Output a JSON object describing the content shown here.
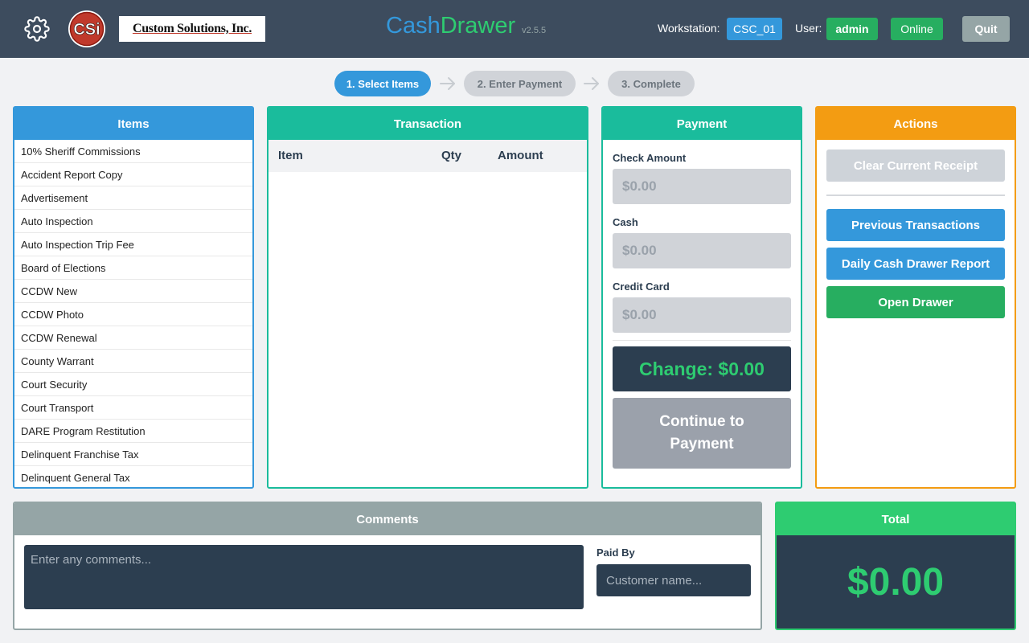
{
  "header": {
    "icons": {
      "settings": "gear-icon",
      "logo": "csi-logo"
    },
    "logo_text": "CSi",
    "company_name": "Custom Solutions, Inc.",
    "app_name_1": "Cash",
    "app_name_2": "Drawer",
    "version": "v2.5.5",
    "workstation_label": "Workstation:",
    "workstation": "CSC_01",
    "user_label": "User:",
    "user": "admin",
    "status": "Online",
    "quit_label": "Quit"
  },
  "steps": [
    {
      "label": "1. Select Items",
      "active": true
    },
    {
      "label": "2. Enter Payment",
      "active": false
    },
    {
      "label": "3. Complete",
      "active": false
    }
  ],
  "items_panel": {
    "title": "Items",
    "items": [
      "10% Sheriff Commissions",
      "Accident Report Copy",
      "Advertisement",
      "Auto Inspection",
      "Auto Inspection Trip Fee",
      "Board of Elections",
      "CCDW New",
      "CCDW Photo",
      "CCDW Renewal",
      "County Warrant",
      "Court Security",
      "Court Transport",
      "DARE Program Restitution",
      "Delinquent Franchise Tax",
      "Delinquent General Tax"
    ]
  },
  "transaction": {
    "title": "Transaction",
    "columns": {
      "item": "Item",
      "qty": "Qty",
      "amount": "Amount"
    },
    "rows": []
  },
  "payment": {
    "title": "Payment",
    "check_label": "Check Amount",
    "check_placeholder": "$0.00",
    "cash_label": "Cash",
    "cash_placeholder": "$0.00",
    "card_label": "Credit Card",
    "card_placeholder": "$0.00",
    "change_text": "Change: $0.00",
    "continue_label": "Continue to Payment"
  },
  "actions": {
    "title": "Actions",
    "clear_label": "Clear Current Receipt",
    "previous_label": "Previous Transactions",
    "report_label": "Daily Cash Drawer Report",
    "open_label": "Open Drawer"
  },
  "comments": {
    "title": "Comments",
    "placeholder": "Enter any comments...",
    "paid_by_label": "Paid By",
    "paid_by_placeholder": "Customer name..."
  },
  "total": {
    "title": "Total",
    "value": "$0.00"
  },
  "colors": {
    "header_bg": "#3d4c5e",
    "blue": "#3498db",
    "green": "#2ecc71",
    "dark_green": "#27ae60",
    "teal": "#1abc9c",
    "orange": "#f39c12",
    "gray": "#95a5a6",
    "navy": "#2c3e50"
  }
}
